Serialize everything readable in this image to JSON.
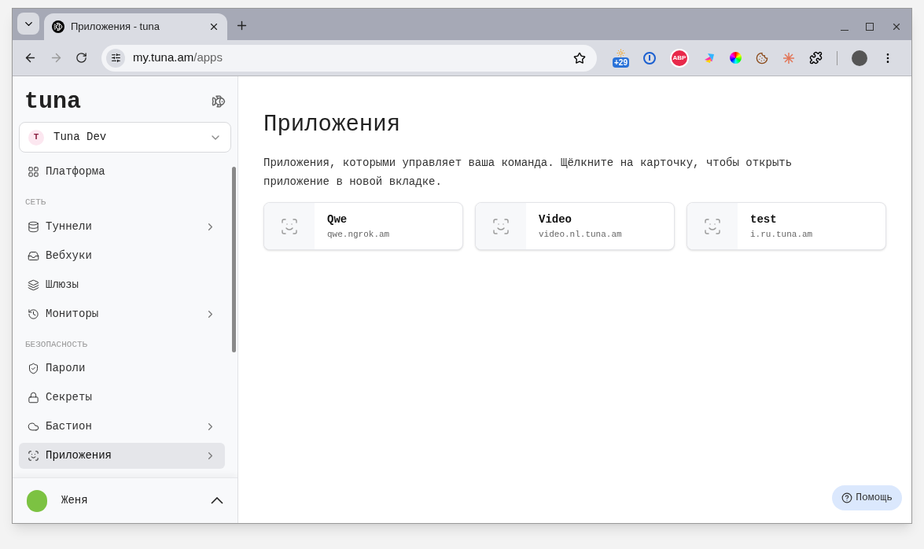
{
  "browser": {
    "tab_title": "Приложения - tuna",
    "url_host": "my.tuna.am",
    "url_path": "/apps",
    "weather_badge": "+29",
    "abp_label": "ABP"
  },
  "sidebar": {
    "logo": "tuna",
    "team": {
      "initial": "T",
      "name": "Tuna Dev"
    },
    "groups": [
      {
        "items": [
          {
            "label": "Платформа",
            "has_submenu": false,
            "selected": false
          }
        ]
      },
      {
        "heading": "СЕТЬ",
        "items": [
          {
            "label": "Туннели",
            "has_submenu": true,
            "selected": false
          },
          {
            "label": "Вебхуки",
            "has_submenu": false,
            "selected": false
          },
          {
            "label": "Шлюзы",
            "has_submenu": false,
            "selected": false
          },
          {
            "label": "Мониторы",
            "has_submenu": true,
            "selected": false
          }
        ]
      },
      {
        "heading": "БЕЗОПАСНОСТЬ",
        "items": [
          {
            "label": "Пароли",
            "has_submenu": false,
            "selected": false
          },
          {
            "label": "Секреты",
            "has_submenu": false,
            "selected": false
          },
          {
            "label": "Бастион",
            "has_submenu": true,
            "selected": false
          },
          {
            "label": "Приложения",
            "has_submenu": true,
            "selected": true
          }
        ]
      }
    ],
    "user": {
      "name": "Женя"
    }
  },
  "main": {
    "title": "Приложения",
    "description": "Приложения, которыми управляет ваша команда. Щёлкните на карточку, чтобы открыть приложение в новой вкладке.",
    "apps": [
      {
        "name": "Qwe",
        "host": "qwe.ngrok.am"
      },
      {
        "name": "Video",
        "host": "video.nl.tuna.am"
      },
      {
        "name": "test",
        "host": "i.ru.tuna.am"
      }
    ],
    "help_button": "Помощь"
  }
}
